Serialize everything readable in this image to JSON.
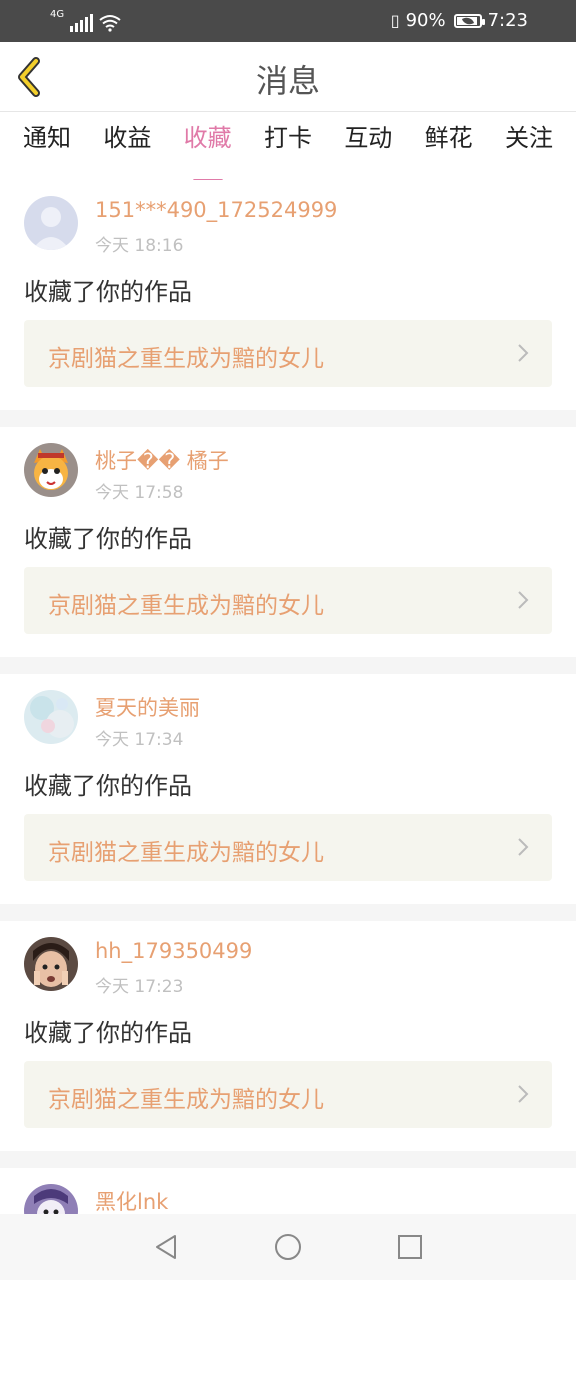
{
  "status_bar": {
    "network": "4G",
    "battery": "90%",
    "time": "7:23"
  },
  "header": {
    "title": "消息"
  },
  "tabs": [
    {
      "label": "通知"
    },
    {
      "label": "收益"
    },
    {
      "label": "收藏"
    },
    {
      "label": "打卡"
    },
    {
      "label": "互动"
    },
    {
      "label": "鲜花"
    },
    {
      "label": "关注"
    }
  ],
  "active_tab": "收藏",
  "messages": [
    {
      "user": "151***490_172524999",
      "time": "今天 18:16",
      "action": "收藏了你的作品",
      "work": "京剧猫之重生成为黯的女儿",
      "avatar": "default-avatar"
    },
    {
      "user": "桃子�� 橘子",
      "time": "今天 17:58",
      "action": "收藏了你的作品",
      "work": "京剧猫之重生成为黯的女儿",
      "avatar": "cartoon-fox-avatar"
    },
    {
      "user": "夏天的美丽",
      "time": "今天 17:34",
      "action": "收藏了你的作品",
      "work": "京剧猫之重生成为黯的女儿",
      "avatar": "pastel-avatar"
    },
    {
      "user": "hh_179350499",
      "time": "今天 17:23",
      "action": "收藏了你的作品",
      "work": "京剧猫之重生成为黯的女儿",
      "avatar": "child-photo-avatar"
    },
    {
      "user": "黑化lnk",
      "time": "",
      "action": "",
      "work": "",
      "avatar": "purple-avatar"
    }
  ],
  "colors": {
    "accent": "#e07aa8",
    "username": "#e7a072",
    "status_bar": "#4a4a4a",
    "back_arrow": "#f3cf2b"
  }
}
